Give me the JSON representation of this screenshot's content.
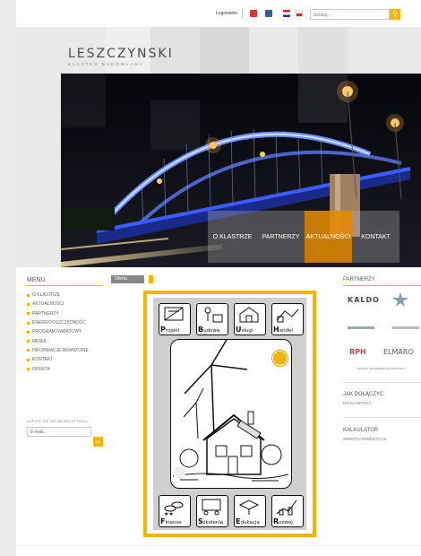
{
  "topbar": {
    "login": "Logowanie",
    "search_placeholder": "Szukaj...",
    "search_icon": "magnifier-icon"
  },
  "brand": {
    "name": "LESZCZYNSKI",
    "tagline": "KLASTER BUDOWLANY"
  },
  "nav": {
    "items": [
      "O KLASTRZE",
      "PARTNERZY",
      "AKTUALNOŚCI",
      "KONTAKT"
    ],
    "active_index": 2
  },
  "menu": {
    "title": "MENU",
    "items": [
      "O KLASTRZE",
      "AKTUALNOŚCI",
      "PARTNERZY",
      "ENERGOOSZCZĘDNOŚĆ",
      "PROGRAM RABATOWY",
      "MEDIA",
      "INFORMACJE BRANŻOWE",
      "KONTAKT",
      "OFERTA"
    ]
  },
  "newsletter": {
    "label": "ZAPISZ SIĘ DO NEWSLETTERA",
    "placeholder": "E-mail...",
    "button": "OK"
  },
  "offer": {
    "tab": "Oferta",
    "top_tiles": [
      {
        "cap": "P",
        "rest": "rojekt"
      },
      {
        "cap": "B",
        "rest": "udowa"
      },
      {
        "cap": "U",
        "rest": "sługi"
      },
      {
        "cap": "H",
        "rest": "andel"
      }
    ],
    "bottom_tiles": [
      {
        "cap": "F",
        "rest": "inanse"
      },
      {
        "cap": "S",
        "rest": "zkolenia"
      },
      {
        "cap": "E",
        "rest": "dukacja"
      },
      {
        "cap": "R",
        "rest": "ozwój"
      }
    ]
  },
  "partners": {
    "title": "PARTNERZY",
    "logos": [
      "KALDO",
      "RPH",
      "ELMARO"
    ],
    "see_all": "zobacz wszystkich partnerów »",
    "join_title": "JAK DOŁĄCZYĆ",
    "join_sub": "DO KLASTRA?",
    "calc_title": "KALKULATOR",
    "calc_sub": "ZWROTU INWESTYCJI"
  },
  "colors": {
    "accent": "#f4b400",
    "bridge_light": "#2f6bff"
  }
}
